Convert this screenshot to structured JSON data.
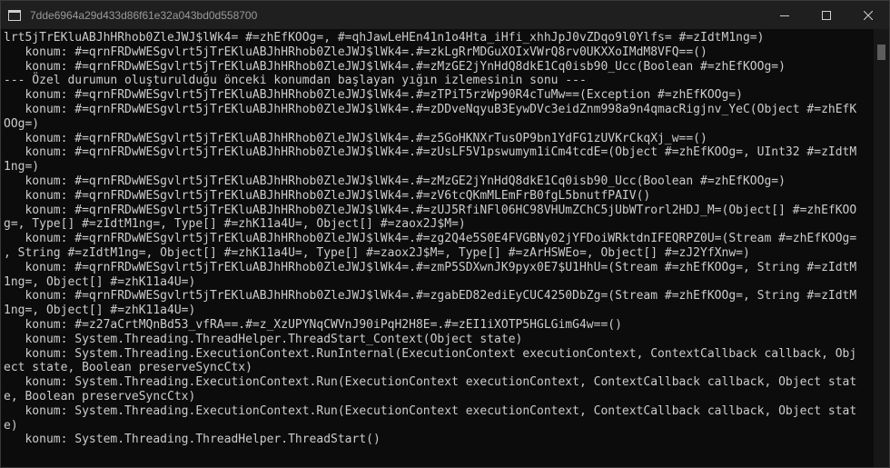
{
  "window": {
    "title": "7dde6964a29d433d86f61e32a043bd0d558700"
  },
  "console": {
    "lines": [
      "lrt5jTrEKluABJhHRhob0ZleJWJ$lWk4= #=zhEfKOOg=, #=qhJawLeHEn41n1o4Hta_iHfi_xhhJpJ0vZDqo9l0Ylfs= #=zIdtM1ng=)",
      "   konum: #=qrnFRDwWESgvlrt5jTrEKluABJhHRhob0ZleJWJ$lWk4=.#=zkLgRrMDGuXOIxVWrQ8rv0UKXXoIMdM8VFQ==()",
      "   konum: #=qrnFRDwWESgvlrt5jTrEKluABJhHRhob0ZleJWJ$lWk4=.#=zMzGE2jYnHdQ8dkE1Cq0isb90_Ucc(Boolean #=zhEfKOOg=)",
      "--- Özel durumun oluşturulduğu önceki konumdan başlayan yığın izlemesinin sonu ---",
      "   konum: #=qrnFRDwWESgvlrt5jTrEKluABJhHRhob0ZleJWJ$lWk4=.#=zTPiT5rzWp90R4cTuMw==(Exception #=zhEfKOOg=)",
      "   konum: #=qrnFRDwWESgvlrt5jTrEKluABJhHRhob0ZleJWJ$lWk4=.#=zDDveNqyuB3EywDVc3eidZnm998a9n4qmacRigjnv_YeC(Object #=zhEfK",
      "OOg=)",
      "   konum: #=qrnFRDwWESgvlrt5jTrEKluABJhHRhob0ZleJWJ$lWk4=.#=z5GoHKNXrTusOP9bn1YdFG1zUVKrCkqXj_w==()",
      "   konum: #=qrnFRDwWESgvlrt5jTrEKluABJhHRhob0ZleJWJ$lWk4=.#=zUsLF5V1pswumym1iCm4tcdE=(Object #=zhEfKOOg=, UInt32 #=zIdtM",
      "1ng=)",
      "   konum: #=qrnFRDwWESgvlrt5jTrEKluABJhHRhob0ZleJWJ$lWk4=.#=zMzGE2jYnHdQ8dkE1Cq0isb90_Ucc(Boolean #=zhEfKOOg=)",
      "   konum: #=qrnFRDwWESgvlrt5jTrEKluABJhHRhob0ZleJWJ$lWk4=.#=zV6tcQKmMLEmFrB0fgL5bnutfPAIV()",
      "   konum: #=qrnFRDwWESgvlrt5jTrEKluABJhHRhob0ZleJWJ$lWk4=.#=zUJ5RfiNFl06HC98VHUmZChC5jUbWTrorl2HDJ_M=(Object[] #=zhEfKOO",
      "g=, Type[] #=zIdtM1ng=, Type[] #=zhK11a4U=, Object[] #=zaox2J$M=)",
      "   konum: #=qrnFRDwWESgvlrt5jTrEKluABJhHRhob0ZleJWJ$lWk4=.#=zg2Q4e5S0E4FVGBNy02jYFDoiWRktdnIFEQRPZ0U=(Stream #=zhEfKOOg=",
      ", String #=zIdtM1ng=, Object[] #=zhK11a4U=, Type[] #=zaox2J$M=, Type[] #=zArHSWEo=, Object[] #=zJ2YfXnw=)",
      "   konum: #=qrnFRDwWESgvlrt5jTrEKluABJhHRhob0ZleJWJ$lWk4=.#=zmP5SDXwnJK9pyx0E7$U1HhU=(Stream #=zhEfKOOg=, String #=zIdtM",
      "1ng=, Object[] #=zhK11a4U=)",
      "   konum: #=qrnFRDwWESgvlrt5jTrEKluABJhHRhob0ZleJWJ$lWk4=.#=zgabED82ediEyCUC4250DbZg=(Stream #=zhEfKOOg=, String #=zIdtM",
      "1ng=, Object[] #=zhK11a4U=)",
      "   konum: #=z27aCrtMQnBd53_vfRA==.#=z_XzUPYNqCWVnJ90iPqH2H8E=.#=zEI1iXOTP5HGLGimG4w==()",
      "   konum: System.Threading.ThreadHelper.ThreadStart_Context(Object state)",
      "   konum: System.Threading.ExecutionContext.RunInternal(ExecutionContext executionContext, ContextCallback callback, Obj",
      "ect state, Boolean preserveSyncCtx)",
      "   konum: System.Threading.ExecutionContext.Run(ExecutionContext executionContext, ContextCallback callback, Object stat",
      "e, Boolean preserveSyncCtx)",
      "   konum: System.Threading.ExecutionContext.Run(ExecutionContext executionContext, ContextCallback callback, Object stat",
      "e)",
      "   konum: System.Threading.ThreadHelper.ThreadStart()"
    ]
  },
  "icons": {
    "app": "console-window-icon",
    "minimize": "minimize-icon",
    "maximize": "maximize-icon",
    "close": "close-icon"
  },
  "colors": {
    "background": "#0c0c0c",
    "titlebar": "#1f1f1f",
    "text": "#cccccc",
    "title_text": "#9a9a9a",
    "scrollbar_thumb": "#5d5d5d"
  }
}
